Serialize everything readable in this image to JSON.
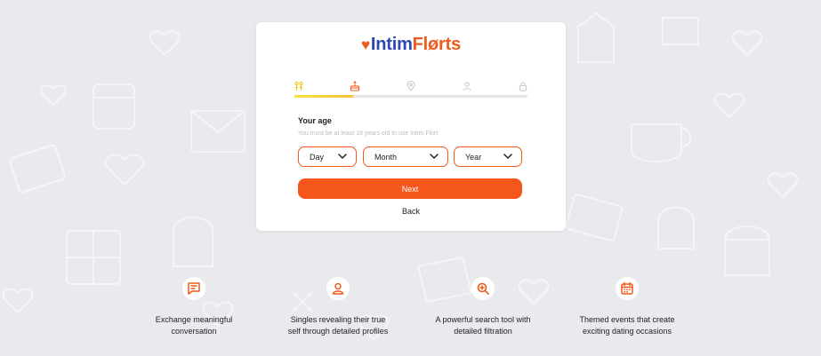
{
  "brand": {
    "name_part1": "Intim",
    "name_part2": "Flørts",
    "heart": "♥"
  },
  "steps": {
    "icons": [
      "gender-icon",
      "cake-icon",
      "location-icon",
      "person-icon",
      "lock-icon"
    ],
    "progress": 0.25,
    "progress_colors": [
      "#f5e23a",
      "#f6c13b"
    ],
    "active_color": "#f0c419",
    "inactive_color": "#c7c9cf"
  },
  "form": {
    "title": "Your age",
    "subtitle": "You must be at least 18 years old to use Intim Flort",
    "day_label": "Day",
    "month_label": "Month",
    "year_label": "Year",
    "next_label": "Next",
    "back_label": "Back"
  },
  "features": [
    {
      "icon": "chat-icon",
      "line1": "Exchange meaningful",
      "line2": "conversation"
    },
    {
      "icon": "user-icon",
      "line1": "Singles revealing their true",
      "line2": "self through detailed profiles"
    },
    {
      "icon": "search-icon",
      "line1": "A powerful search tool with",
      "line2": "detailed filtration"
    },
    {
      "icon": "calendar-icon",
      "line1": "Themed events that create",
      "line2": "exciting dating occasions"
    }
  ],
  "colors": {
    "accent": "#f05a1a",
    "brand_blue": "#2d47b5",
    "background": "#e9eaee"
  }
}
